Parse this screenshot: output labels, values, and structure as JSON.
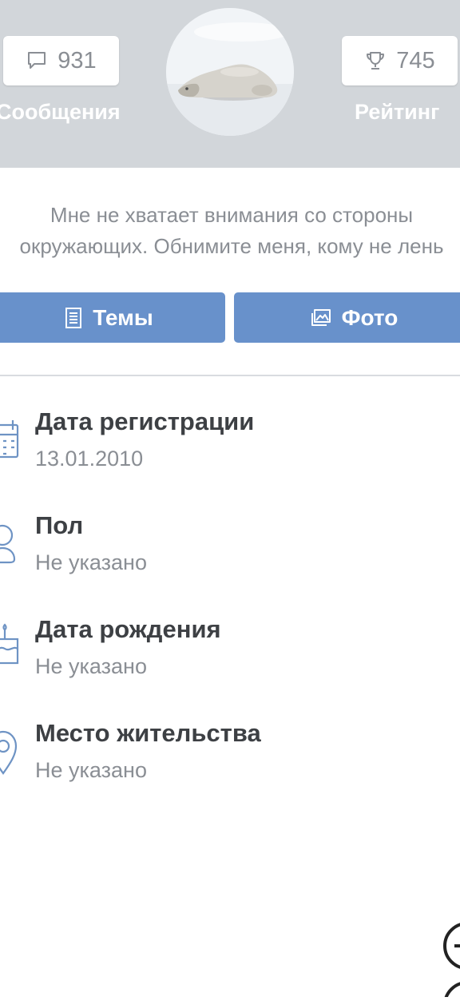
{
  "profile": {
    "messages": {
      "count": "931",
      "label": "Сообщения",
      "icon": "speech-bubble-icon"
    },
    "rating": {
      "count": "745",
      "label": "Рейтинг",
      "icon": "trophy-icon"
    },
    "avatar": "polar-bear-lying-on-snow",
    "status_lines": [
      "Мне не хватает внимания со стороны",
      "окружающих. Обнимите меня, кому не лень"
    ]
  },
  "actions": {
    "topics": {
      "label": "Темы",
      "icon": "document-list-icon"
    },
    "photos": {
      "label": "Фото",
      "icon": "photo-gallery-icon"
    }
  },
  "info": [
    {
      "title": "Дата регистрации",
      "value": "13.01.2010",
      "icon": "calendar-icon"
    },
    {
      "title": "Пол",
      "value": "Не указано",
      "icon": "person-icon"
    },
    {
      "title": "Дата рождения",
      "value": "Не указано",
      "icon": "cake-icon"
    },
    {
      "title": "Место жительства",
      "value": "Не указано",
      "icon": "location-pin-icon"
    }
  ],
  "colors": {
    "header_bg": "#d2d6da",
    "button_bg": "#6891cb",
    "icon_blue": "#6e93c4",
    "muted_text": "#8a8e94",
    "title_text": "#3d4044"
  }
}
